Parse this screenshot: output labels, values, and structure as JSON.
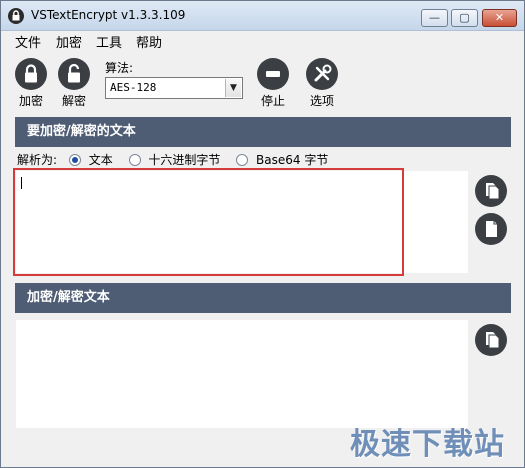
{
  "window": {
    "title": "VSTextEncrypt v1.3.3.109",
    "controls": {
      "minimize": "—",
      "maximize": "▢",
      "close": "✕"
    }
  },
  "menu": [
    "文件",
    "加密",
    "工具",
    "帮助"
  ],
  "toolbar": {
    "encrypt_label": "加密",
    "decrypt_label": "解密",
    "algorithm_label": "算法:",
    "algorithm_value": "AES-128",
    "stop_label": "停止",
    "options_label": "选项"
  },
  "input_section": {
    "header": "要加密/解密的文本",
    "parse_label": "解析为:",
    "parse_options": [
      {
        "label": "文本",
        "checked": true
      },
      {
        "label": "十六进制字节",
        "checked": false
      },
      {
        "label": "Base64 字节",
        "checked": false
      }
    ],
    "text_value": ""
  },
  "output_section": {
    "header": "加密/解密文本",
    "text_value": ""
  },
  "icons": {
    "paste": "paste-icon",
    "new": "new-document-icon",
    "copy": "copy-icon"
  },
  "watermark": "极速下载站",
  "colors": {
    "section_header": "#4e5d74",
    "icon_bg": "#3b3f44",
    "highlight": "#d63b3b",
    "watermark": "#6f8fb8"
  }
}
